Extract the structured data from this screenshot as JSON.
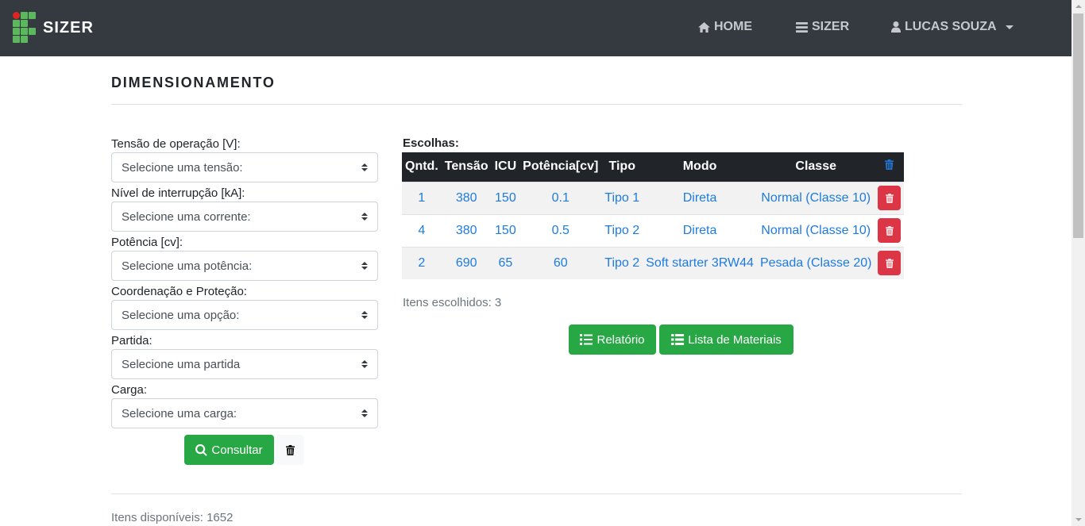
{
  "navbar": {
    "brand": "SIZER",
    "home": "HOME",
    "sizer": "SIZER",
    "user": "LUCAS SOUZA",
    "bg_color": "#343a40"
  },
  "page": {
    "title": "DIMENSIONAMENTO"
  },
  "form": {
    "fields": [
      {
        "label": "Tensão de operação [V]:",
        "placeholder": "Selecione uma tensão:"
      },
      {
        "label": "Nível de interrupção [kA]:",
        "placeholder": "Selecione uma corrente:"
      },
      {
        "label": "Potência [cv]:",
        "placeholder": "Selecione uma potência:"
      },
      {
        "label": "Coordenação e Proteção:",
        "placeholder": "Selecione uma opção:"
      },
      {
        "label": "Partida:",
        "placeholder": "Selecione uma partida"
      },
      {
        "label": "Carga:",
        "placeholder": "Selecione uma carga:"
      }
    ],
    "consult_label": "Consultar"
  },
  "choices": {
    "title": "Escolhas:",
    "columns": [
      "Qntd.",
      "Tensão",
      "ICU",
      "Potência[cv]",
      "Tipo",
      "Modo",
      "Classe"
    ],
    "rows": [
      [
        "1",
        "380",
        "150",
        "0.1",
        "Tipo 1",
        "Direta",
        "Normal (Classe 10)"
      ],
      [
        "4",
        "380",
        "150",
        "0.5",
        "Tipo 2",
        "Direta",
        "Normal (Classe 10)"
      ],
      [
        "2",
        "690",
        "65",
        "60",
        "Tipo 2",
        "Soft starter 3RW44",
        "Pesada (Classe 20)"
      ]
    ],
    "count_text": "Itens escolhidos: 3",
    "report_label": "Relatório",
    "materials_label": "Lista de Materiais"
  },
  "footer": {
    "available_text": "Itens disponíveis: 1652"
  },
  "colors": {
    "success": "#28a745",
    "danger": "#dc3545",
    "link": "#1e7be0",
    "table_head": "#212529"
  },
  "icons": {
    "home": "home-icon",
    "sizer": "list-icon",
    "user": "user-icon",
    "search": "search-icon",
    "trash": "trash-icon",
    "report": "list-ol-icon",
    "materials": "list-icon"
  }
}
